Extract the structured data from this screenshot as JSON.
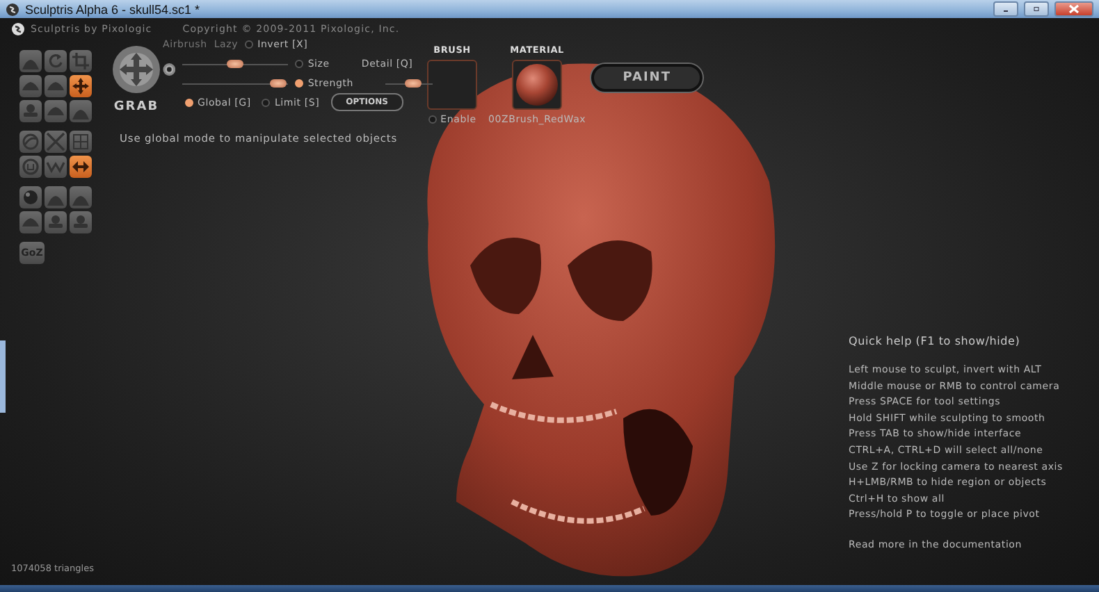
{
  "window": {
    "title": "Sculptris Alpha 6 - skull54.sc1 *"
  },
  "header": {
    "app_name": "Sculptris by Pixologic",
    "copyright": "Copyright © 2009-2011 Pixologic, Inc."
  },
  "tool_groups": [
    [
      {
        "kind": "bump",
        "selected": false
      },
      {
        "kind": "rotate",
        "selected": false
      },
      {
        "kind": "crop",
        "selected": false
      },
      {
        "kind": "hill",
        "selected": false
      },
      {
        "kind": "hill",
        "selected": false
      },
      {
        "kind": "arrows",
        "selected": true
      },
      {
        "kind": "blob",
        "selected": false
      },
      {
        "kind": "hill",
        "selected": false
      },
      {
        "kind": "bump",
        "selected": false
      }
    ],
    [
      {
        "kind": "swirl",
        "selected": false
      },
      {
        "kind": "cross",
        "selected": false
      },
      {
        "kind": "grid",
        "selected": false
      },
      {
        "kind": "ring",
        "selected": false
      },
      {
        "kind": "zigzag",
        "selected": false
      },
      {
        "kind": "double-arrow",
        "selected": true
      }
    ],
    [
      {
        "kind": "sphere",
        "selected": false
      },
      {
        "kind": "bump",
        "selected": false
      },
      {
        "kind": "bump",
        "selected": false
      },
      {
        "kind": "hill",
        "selected": false
      },
      {
        "kind": "blob",
        "selected": false
      },
      {
        "kind": "blob",
        "selected": false
      }
    ]
  ],
  "goz_button": "GoZ",
  "brush": {
    "tool_name": "GRAB",
    "airbrush": "Airbrush",
    "lazy": "Lazy",
    "toggles": [
      {
        "label": "Invert [X]",
        "on": false
      },
      {
        "label": "Size",
        "on": false
      },
      {
        "label": "Strength",
        "on": true
      },
      {
        "label": "Global [G]",
        "on": true
      },
      {
        "label": "Limit [S]",
        "on": false
      }
    ],
    "size_slider": {
      "level": 0.5
    },
    "strength_slider": {
      "level": 0.9
    },
    "detail": {
      "label": "Detail [Q]",
      "level": 0.6
    },
    "options_button": "OPTIONS",
    "brush_heading": "BRUSH",
    "enable": {
      "label": "Enable",
      "on": false
    },
    "material_heading": "MATERIAL",
    "material_name": "00ZBrush_RedWax",
    "paint_button": "PAINT"
  },
  "hint": "Use global mode to manipulate selected objects",
  "quick_help": {
    "title": "Quick help (F1 to show/hide)",
    "lines": [
      "Left mouse to sculpt, invert with ALT",
      "Middle mouse or RMB to control camera",
      "Press SPACE for tool settings",
      "Hold SHIFT while sculpting to smooth",
      "Press TAB to show/hide interface",
      "CTRL+A, CTRL+D will select all/none",
      "Use Z for locking camera to nearest axis",
      "H+LMB/RMB to hide region or objects",
      "Ctrl+H to show all",
      "Press/hold P to toggle or place pivot"
    ],
    "footer": "Read more in the documentation"
  },
  "status": "1074058 triangles"
}
